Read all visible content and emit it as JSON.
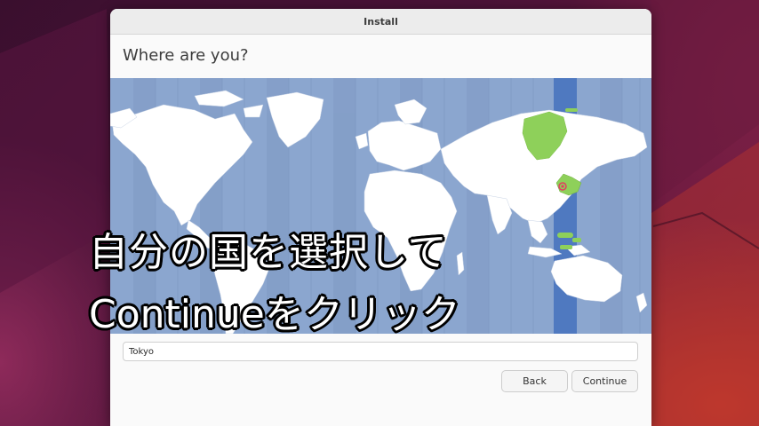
{
  "window": {
    "title": "Install"
  },
  "page": {
    "title": "Where are you?"
  },
  "map": {
    "ocean_color": "#8ba6cf",
    "land_color": "#ffffff",
    "selected_timezone_color": "#4f79c0",
    "selected_region_color": "#8ed05a",
    "pin_color": "#e04060"
  },
  "location": {
    "value": "Tokyo"
  },
  "buttons": {
    "back_label": "Back",
    "continue_label": "Continue"
  },
  "overlay": {
    "line1": "自分の国を選択して",
    "line2": "Continueをクリック"
  }
}
